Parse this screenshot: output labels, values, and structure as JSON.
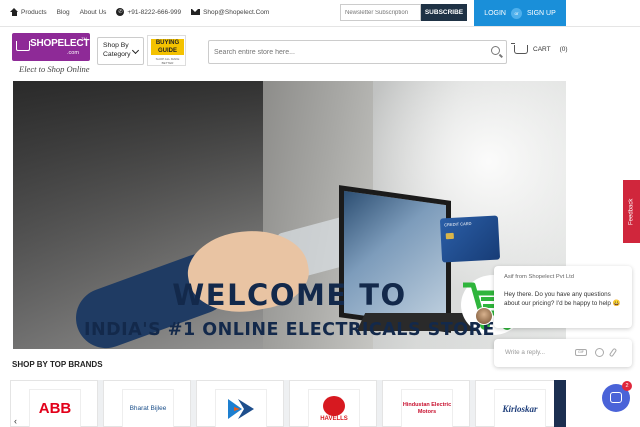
{
  "topnav": {
    "products": "Products",
    "blog": "Blog",
    "about": "About Us",
    "phone": "+91-8222-666-999",
    "email": "Shop@Shopelect.Com"
  },
  "newsletter": {
    "placeholder": "Newsletter Subscription",
    "button": "SUBSCRIBE"
  },
  "auth": {
    "login": "LOGIN",
    "or": "or",
    "signup": "SIGN UP"
  },
  "logo": {
    "name": "SHOPELECT",
    "tld": ".com",
    "tm": "TM",
    "tagline": "Elect to Shop Online"
  },
  "shop_by": {
    "line1": "Shop By",
    "line2": "Category"
  },
  "guide": {
    "title_line1": "BUYING",
    "title_line2": "GUIDE",
    "sub": "SHOP ALL MAKE BETTER"
  },
  "search": {
    "placeholder": "Search entire store here..."
  },
  "cart": {
    "label": "CART",
    "count": "(0)"
  },
  "hero": {
    "title": "WELCOME TO",
    "subtitle": "INDIA'S #1 ONLINE ELECTRICALS STORE",
    "card_text": "CREDIT CARD"
  },
  "brands": {
    "title": "SHOP BY TOP BRANDS",
    "items": [
      "ABB",
      "Bharat Bijlee",
      "",
      "HAVELLS",
      "Hindustan Electric Motors",
      "Kirloskar"
    ]
  },
  "feedback": {
    "label": "Feedback"
  },
  "chat": {
    "from": "Asif from Shopelect Pvt Ltd",
    "message": "Hey there. Do you have any questions about our pricing? I'd be happy to help 😀",
    "reply_placeholder": "Write a reply...",
    "gif": "GIF",
    "badge": "2"
  },
  "colors": {
    "brand_purple": "#8e2a97",
    "login_blue": "#1a8fd9",
    "subscribe_navy": "#1f3245",
    "hero_text": "#13294b",
    "chat_launcher": "#4a63d8",
    "feedback_red": "#d0263c"
  }
}
